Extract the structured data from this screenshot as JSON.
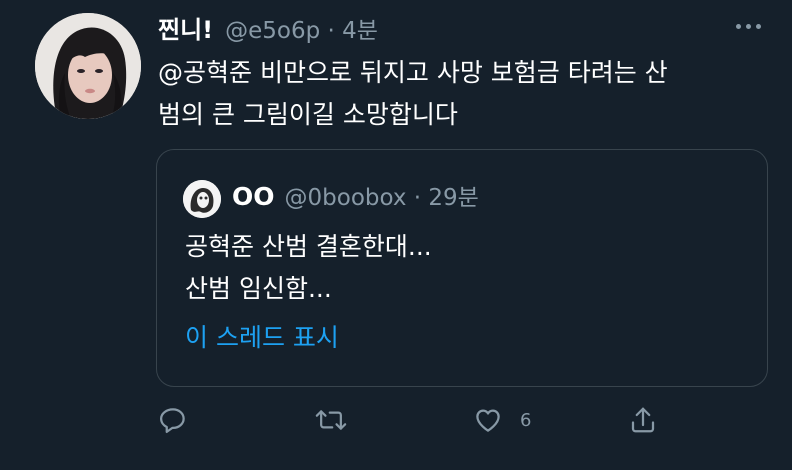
{
  "tweet": {
    "display_name": "찐니!",
    "meta": "@e5o6p · 4분",
    "text": "@공혁준 비만으로 뒤지고 사망 보험금 타려는 산\n범의 큰 그림이길 소망합니다",
    "avatar_icon": "user-avatar-photo",
    "more_icon": "more-horizontal-icon"
  },
  "quote": {
    "display_name": "OO",
    "meta": "@0boobox · 29분",
    "text": "공혁준 산범 결혼한대...\n산범 임신함...",
    "show_thread": "이 스레드 표시",
    "avatar_icon": "quoted-user-avatar"
  },
  "actions": {
    "reply_icon": "reply-icon",
    "retweet_icon": "retweet-icon",
    "like_icon": "heart-icon",
    "like_count": "6",
    "share_icon": "share-icon"
  },
  "colors": {
    "background": "#15202b",
    "text_primary": "#ffffff",
    "text_secondary": "#8899a6",
    "accent": "#1da1f2",
    "border": "#38444d"
  }
}
